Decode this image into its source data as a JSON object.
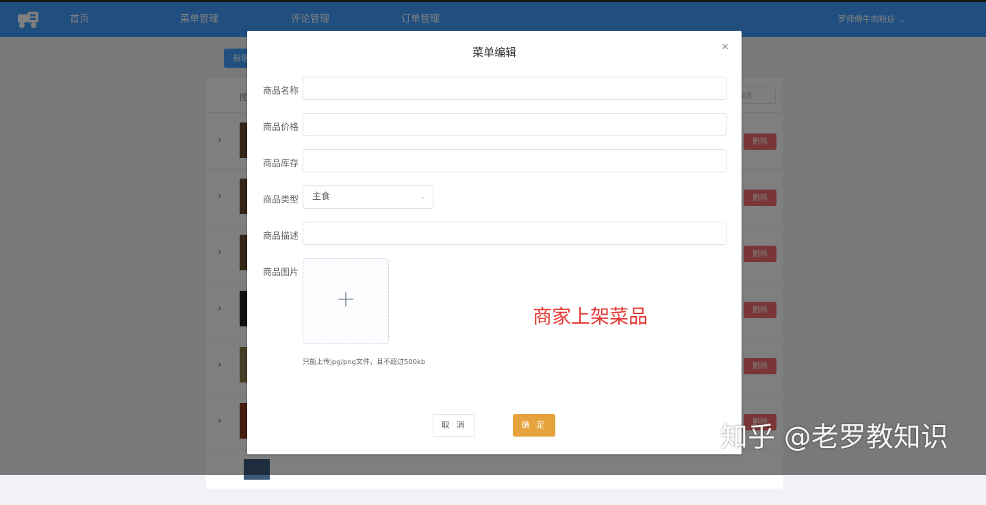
{
  "header": {
    "nav": [
      "首页",
      "菜单管理",
      "评论管理",
      "订单管理"
    ],
    "user": "罗师傅牛肉粉店"
  },
  "page": {
    "add_button": "新增",
    "table_header_image": "图",
    "search_placeholder": "搜索",
    "delete_label": "删除"
  },
  "dialog": {
    "title": "菜单编辑",
    "fields": {
      "name_label": "商品名称",
      "price_label": "商品价格",
      "stock_label": "商品库存",
      "type_label": "商品类型",
      "type_value": "主食",
      "desc_label": "商品描述",
      "image_label": "商品图片"
    },
    "upload_tip": "只能上传jpg/png文件，且不超过500kb",
    "cancel_label": "取 消",
    "confirm_label": "确 定"
  },
  "annotation": "商家上架菜品",
  "watermark": "知乎 @老罗教知识",
  "colors": {
    "primary": "#409eff",
    "danger": "#f56c6c",
    "warning": "#e6a23c",
    "annotation": "#e53935"
  },
  "icons": {
    "logo": "truck-logo-icon",
    "close": "close-icon",
    "select": "chevron-down-icon",
    "upload": "plus-icon",
    "expand": "chevron-right-icon"
  }
}
